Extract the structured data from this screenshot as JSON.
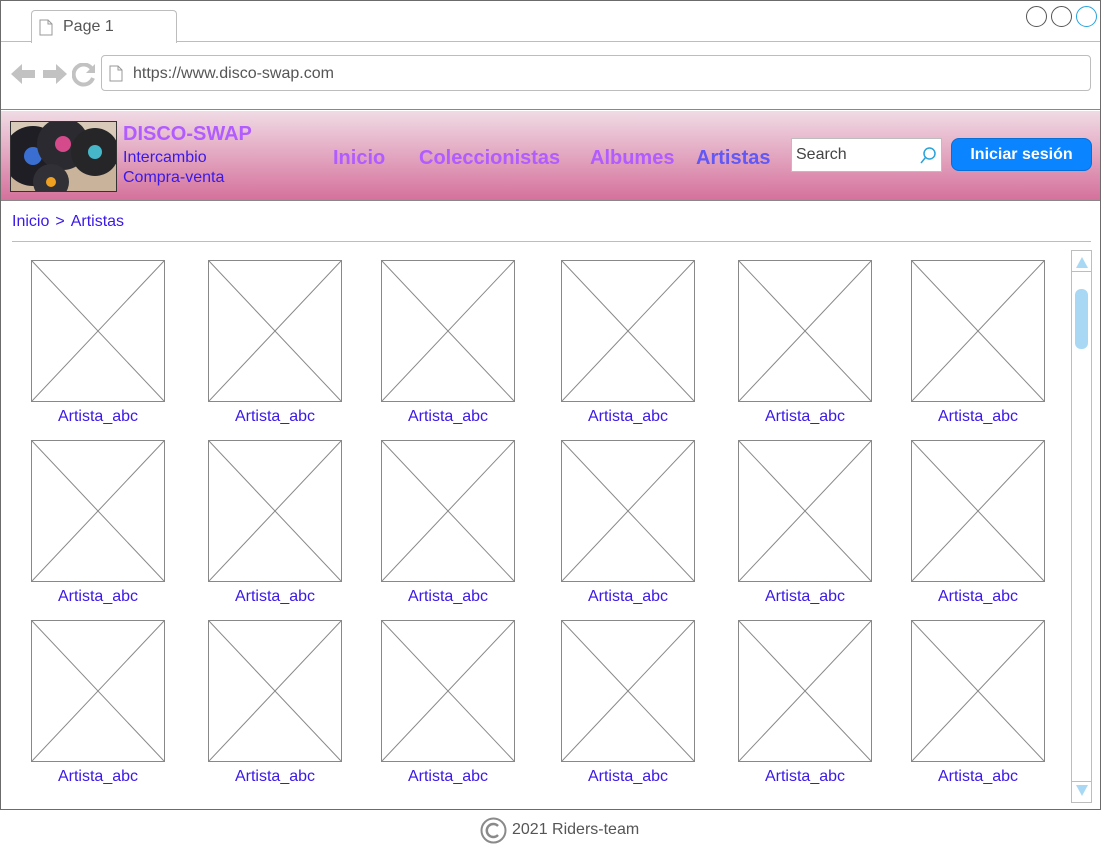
{
  "browser": {
    "tab_label": "Page 1",
    "url": "https://www.disco-swap.com"
  },
  "site": {
    "brand": "DISCO-SWAP",
    "tagline_1": "Intercambio",
    "tagline_2": "Compra-venta",
    "nav": [
      {
        "label": "Inicio"
      },
      {
        "label": "Coleccionistas"
      },
      {
        "label": "Albumes"
      },
      {
        "label": "Artistas"
      }
    ],
    "active_nav": "Artistas",
    "search_placeholder": "Search",
    "login_label": "Iniciar sesión"
  },
  "breadcrumb": {
    "items": [
      "Inicio",
      ">",
      "Artistas"
    ]
  },
  "artists": [
    "Artista_abc",
    "Artista_abc",
    "Artista_abc",
    "Artista_abc",
    "Artista_abc",
    "Artista_abc",
    "Artista_abc",
    "Artista_abc",
    "Artista_abc",
    "Artista_abc",
    "Artista_abc",
    "Artista_abc",
    "Artista_abc",
    "Artista_abc",
    "Artista_abc",
    "Artista_abc",
    "Artista_abc",
    "Artista_abc"
  ],
  "footer": {
    "text": "2021 Riders-team"
  },
  "colors": {
    "link": "#3a19e8",
    "nav": "#b05cff",
    "nav_active": "#6158f5",
    "header_top": "#f0dbe4",
    "header_bottom": "#d5719c",
    "button": "#0a84ff",
    "scroll_accent": "#a9d8f5"
  },
  "icons": {
    "back": "arrow-left-icon",
    "forward": "arrow-right-icon",
    "reload": "reload-icon",
    "page": "page-icon",
    "search": "search-icon",
    "copyright": "copyright-icon",
    "placeholder": "image-placeholder-icon"
  }
}
